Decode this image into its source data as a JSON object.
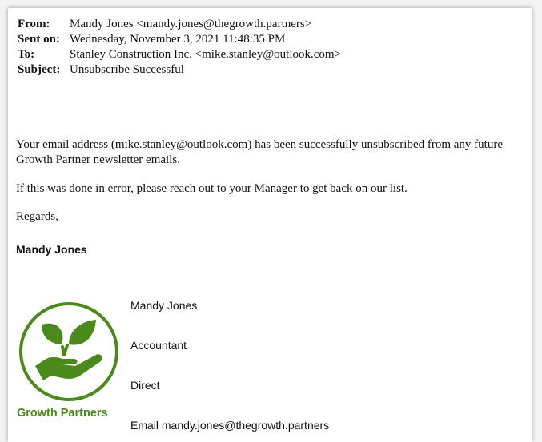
{
  "header": {
    "from_label": "From:",
    "from_value": "Mandy Jones <mandy.jones@thegrowth.partners>",
    "sent_label": "Sent on:",
    "sent_value": "Wednesday, November 3, 2021 11:48:35 PM",
    "to_label": "To:",
    "to_value": "Stanley Construction Inc. <mike.stanley@outlook.com>",
    "subject_label": "Subject:",
    "subject_value": "Unsubscribe Successful"
  },
  "body": {
    "paragraph1": "Your email address (mike.stanley@outlook.com) has been successfully unsubscribed from any future Growth Partner newsletter emails.",
    "paragraph2": "If this was done in error, please reach out to your Manager to get back on our list.",
    "regards": "Regards,",
    "signature_name": "Mandy Jones"
  },
  "signature": {
    "logo_text": "Growth Partners",
    "logo_color": "#4a8a1a",
    "name": "Mandy Jones",
    "title": "Accountant",
    "direct": "Direct",
    "email": "Email mandy.jones@thegrowth.partners"
  }
}
